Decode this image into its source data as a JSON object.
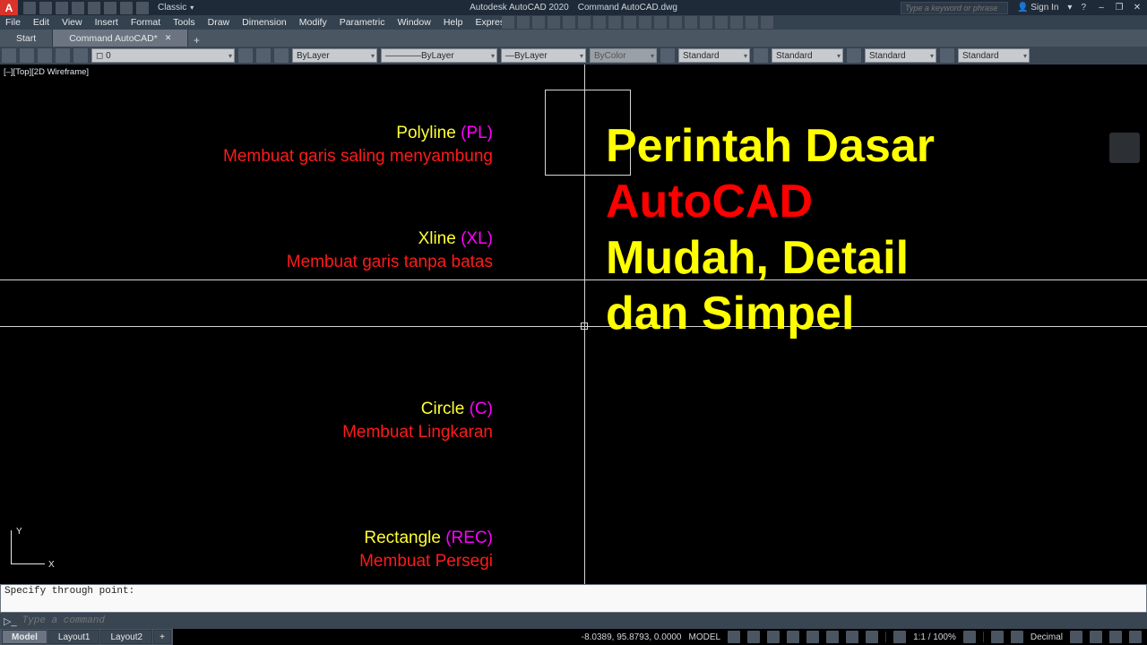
{
  "app": {
    "product": "Autodesk AutoCAD 2020",
    "document": "Command AutoCAD.dwg",
    "workspace": "Classic",
    "search_placeholder": "Type a keyword or phrase",
    "sign_in": "Sign In"
  },
  "menu": [
    "File",
    "Edit",
    "View",
    "Insert",
    "Format",
    "Tools",
    "Draw",
    "Dimension",
    "Modify",
    "Parametric",
    "Window",
    "Help",
    "Express"
  ],
  "file_tabs": {
    "start": "Start",
    "active": "Command AutoCAD*"
  },
  "props": {
    "layer": "ByLayer",
    "linetype": "ByLayer",
    "lineweight": "ByLayer",
    "color": "ByColor",
    "text_style": "Standard",
    "dim_style": "Standard",
    "table_style": "Standard",
    "ml_style": "Standard"
  },
  "viewport": "[–][Top][2D Wireframe]",
  "commands": {
    "polyline": {
      "name": "Polyline",
      "short": "(PL)",
      "desc": "Membuat garis saling menyambung"
    },
    "xline": {
      "name": "Xline",
      "short": "(XL)",
      "desc": "Membuat garis tanpa batas"
    },
    "circle": {
      "name": "Circle",
      "short": "(C)",
      "desc": "Membuat Lingkaran"
    },
    "rectangle": {
      "name": "Rectangle",
      "short": "(REC)",
      "desc": "Membuat Persegi"
    }
  },
  "headline": {
    "line1": "Perintah Dasar",
    "line2": "AutoCAD",
    "line3": "Mudah, Detail",
    "line4": "dan Simpel"
  },
  "ucs": {
    "y": "Y",
    "x": "X"
  },
  "command_line": {
    "history": "Specify through point:",
    "placeholder": "Type a command"
  },
  "layout_tabs": {
    "model": "Model",
    "l1": "Layout1",
    "l2": "Layout2"
  },
  "status": {
    "coords": "-8.0389, 95.8793, 0.0000",
    "space": "MODEL",
    "scale": "1:1 / 100%",
    "units": "Decimal"
  }
}
